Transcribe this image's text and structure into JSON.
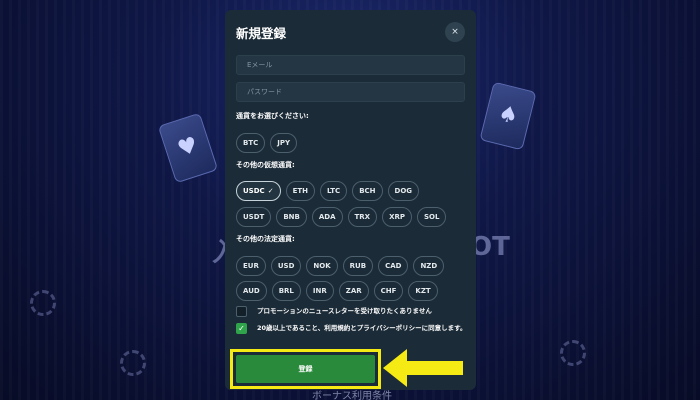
{
  "background": {
    "text_left": "入",
    "text_right": "OT",
    "footer_text": "ボーナス利用条件"
  },
  "modal": {
    "title": "新規登録",
    "close_label": "×",
    "email_placeholder": "Eメール",
    "password_placeholder": "パスワード",
    "currency_label": "通貨をお選びください:",
    "primary_currencies": [
      "BTC",
      "JPY"
    ],
    "crypto_label": "その他の仮想通貨:",
    "crypto_row1": [
      "USDC",
      "ETH",
      "LTC",
      "BCH",
      "DOG"
    ],
    "crypto_row2": [
      "USDT",
      "BNB",
      "ADA",
      "TRX",
      "XRP",
      "SOL"
    ],
    "fiat_label": "その他の法定通貨:",
    "fiat_row1": [
      "EUR",
      "USD",
      "NOK",
      "RUB",
      "CAD",
      "NZD"
    ],
    "fiat_row2": [
      "AUD",
      "BRL",
      "INR",
      "ZAR",
      "CHF",
      "KZT"
    ],
    "selected_currency": "USDC",
    "newsletter_label": "プロモーションのニュースレターを受け取りたくありません",
    "newsletter_checked": false,
    "terms_label": "20歳以上であること、利用規約とプライバシーポリシーに同意します。",
    "terms_checked": true,
    "register_label": "登録"
  },
  "colors": {
    "highlight": "#f5ea14",
    "register_button": "#2a8a3c",
    "checkbox_checked": "#2fa44a"
  }
}
